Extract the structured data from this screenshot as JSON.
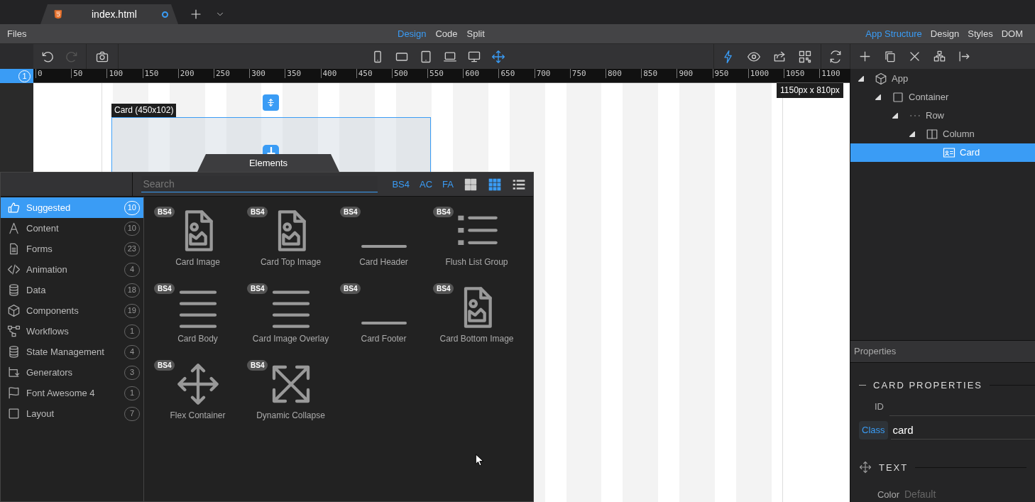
{
  "document_tab": {
    "title": "index.html",
    "unsaved": true
  },
  "menu": {
    "files": "Files",
    "views": [
      {
        "label": "Design",
        "selected": true
      },
      {
        "label": "Code",
        "selected": false
      },
      {
        "label": "Split",
        "selected": false
      }
    ],
    "panels": [
      {
        "label": "App Structure",
        "selected": true
      },
      {
        "label": "Design",
        "selected": false
      },
      {
        "label": "Styles",
        "selected": false
      },
      {
        "label": "DOM",
        "selected": false
      }
    ]
  },
  "history": [
    {
      "kind": "undo",
      "disabled": false
    },
    {
      "kind": "redo",
      "disabled": true
    }
  ],
  "devices": [
    {
      "kind": "phone",
      "selected": false
    },
    {
      "kind": "tablet-landscape",
      "selected": false
    },
    {
      "kind": "tablet",
      "selected": false
    },
    {
      "kind": "laptop",
      "selected": false
    },
    {
      "kind": "desktop",
      "selected": false
    },
    {
      "kind": "move",
      "selected": true
    }
  ],
  "tools": [
    {
      "kind": "bolt",
      "on": true
    },
    {
      "kind": "eye",
      "on": false
    },
    {
      "kind": "share",
      "on": false
    },
    {
      "kind": "qr",
      "on": false
    }
  ],
  "page_number": "1",
  "ruler": [
    "0",
    "50",
    "100",
    "150",
    "200",
    "250",
    "300",
    "350",
    "400",
    "450",
    "500",
    "550",
    "600",
    "650",
    "700",
    "750",
    "800",
    "850",
    "900",
    "950",
    "1000",
    "1050",
    "1100"
  ],
  "canvas": {
    "selection_label": "Card (450x102)",
    "viewport_size": "1150px x 810px"
  },
  "elements_panel": {
    "title": "Elements",
    "search_placeholder": "Search",
    "filters": [
      "BS4",
      "AC",
      "FA"
    ],
    "view_modes": [
      {
        "kind": "large",
        "selected": false
      },
      {
        "kind": "small",
        "selected": true
      },
      {
        "kind": "list",
        "selected": false
      }
    ],
    "categories": [
      {
        "label": "Suggested",
        "count": "10",
        "selected": true
      },
      {
        "label": "Content",
        "count": "10",
        "selected": false
      },
      {
        "label": "Forms",
        "count": "23",
        "selected": false
      },
      {
        "label": "Animation",
        "count": "4",
        "selected": false
      },
      {
        "label": "Data",
        "count": "18",
        "selected": false
      },
      {
        "label": "Components",
        "count": "19",
        "selected": false
      },
      {
        "label": "Workflows",
        "count": "1",
        "selected": false
      },
      {
        "label": "State Management",
        "count": "4",
        "selected": false
      },
      {
        "label": "Generators",
        "count": "3",
        "selected": false
      },
      {
        "label": "Font Awesome 4",
        "count": "1",
        "selected": false
      },
      {
        "label": "Layout",
        "count": "7",
        "selected": false
      }
    ],
    "items": [
      {
        "label": "Card Image",
        "badge": "BS4",
        "kind": "image"
      },
      {
        "label": "Card Top Image",
        "badge": "BS4",
        "kind": "image"
      },
      {
        "label": "Card Header",
        "badge": "BS4",
        "kind": "header"
      },
      {
        "label": "Flush List Group",
        "badge": "BS4",
        "kind": "list"
      },
      {
        "label": "Card Body",
        "badge": "BS4",
        "kind": "lines"
      },
      {
        "label": "Card Image Overlay",
        "badge": "BS4",
        "kind": "lines"
      },
      {
        "label": "Card Footer",
        "badge": "BS4",
        "kind": "footer"
      },
      {
        "label": "Card Bottom Image",
        "badge": "BS4",
        "kind": "image"
      },
      {
        "label": "Flex Container",
        "badge": "BS4",
        "kind": "move"
      },
      {
        "label": "Dynamic Collapse",
        "badge": "BS4",
        "kind": "expand"
      }
    ]
  },
  "structure": [
    {
      "label": "App",
      "kind": "app",
      "selected": false,
      "expanded": true,
      "children": [
        {
          "label": "Container",
          "kind": "container",
          "selected": false,
          "expanded": true,
          "children": [
            {
              "label": "Row",
              "kind": "row",
              "selected": false,
              "expanded": true,
              "children": [
                {
                  "label": "Column",
                  "kind": "column",
                  "selected": false,
                  "expanded": true,
                  "children": [
                    {
                      "label": "Card",
                      "kind": "card",
                      "selected": true
                    }
                  ]
                }
              ]
            }
          ]
        }
      ]
    }
  ],
  "properties": {
    "title": "Properties",
    "section": "CARD PROPERTIES",
    "fields": [
      {
        "label": "ID",
        "highlighted": false
      },
      {
        "label": "Class",
        "value": "card",
        "highlighted": true
      }
    ],
    "text_section": "TEXT",
    "color_label": "Color",
    "color_placeholder": "Default"
  }
}
